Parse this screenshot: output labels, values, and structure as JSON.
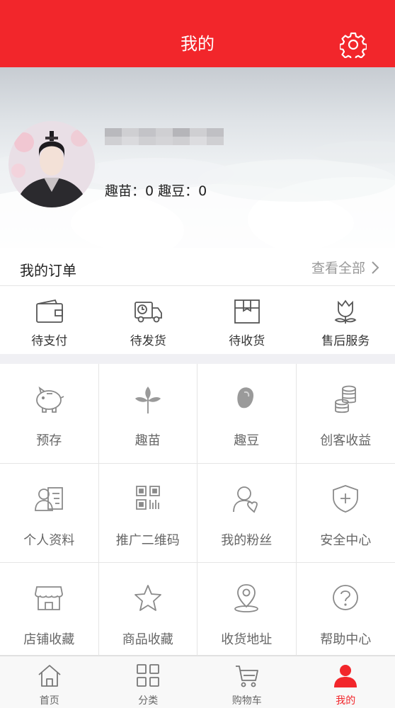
{
  "header": {
    "title": "我的"
  },
  "profile": {
    "stats": "趣苗：0  趣豆：0"
  },
  "orders": {
    "title": "我的订单",
    "view_all": "查看全部",
    "items": [
      {
        "label": "待支付",
        "icon": "wallet-icon"
      },
      {
        "label": "待发货",
        "icon": "delivery-truck-icon"
      },
      {
        "label": "待收货",
        "icon": "package-icon"
      },
      {
        "label": "售后服务",
        "icon": "flower-icon"
      }
    ]
  },
  "grid": [
    {
      "label": "预存",
      "icon": "piggy-bank-icon"
    },
    {
      "label": "趣苗",
      "icon": "seedling-icon"
    },
    {
      "label": "趣豆",
      "icon": "bean-icon"
    },
    {
      "label": "创客收益",
      "icon": "coins-icon"
    },
    {
      "label": "个人资料",
      "icon": "profile-card-icon"
    },
    {
      "label": "推广二维码",
      "icon": "qr-code-icon"
    },
    {
      "label": "我的粉丝",
      "icon": "user-heart-icon"
    },
    {
      "label": "安全中心",
      "icon": "shield-plus-icon"
    },
    {
      "label": "店铺收藏",
      "icon": "store-icon"
    },
    {
      "label": "商品收藏",
      "icon": "star-icon"
    },
    {
      "label": "收货地址",
      "icon": "location-pin-icon"
    },
    {
      "label": "帮助中心",
      "icon": "question-icon"
    }
  ],
  "tabs": [
    {
      "label": "首页",
      "icon": "home-icon"
    },
    {
      "label": "分类",
      "icon": "category-grid-icon"
    },
    {
      "label": "购物车",
      "icon": "cart-icon"
    },
    {
      "label": "我的",
      "icon": "user-icon",
      "active": true
    }
  ],
  "colors": {
    "brand": "#f2262b",
    "icon_gray": "#8a8a8a",
    "divider": "#f0f0f4"
  }
}
